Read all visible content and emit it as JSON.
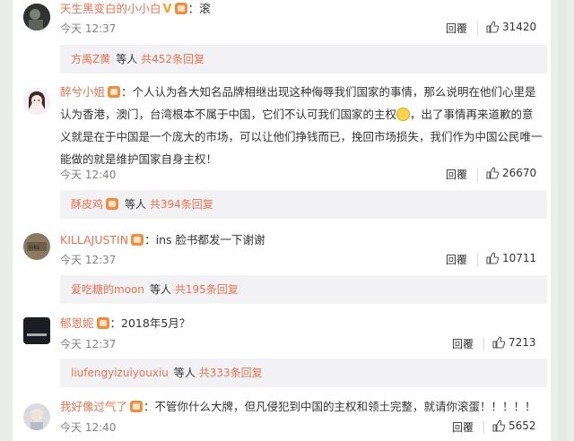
{
  "comments": [
    {
      "username": "天生黑变白的小小白",
      "text": "：滚",
      "time": "今天 12:37",
      "reply": "回覆",
      "likes": "31420",
      "sub_name": "方禹Z黄",
      "sub_etc": "等人",
      "sub_count": "共452条回复"
    },
    {
      "username": "醉兮小姐",
      "text_line1": "：个人认为各大知名品牌相继出现这种侮辱我们国家的事情，那么说明在他们心里是",
      "text_line2a": "认为香港，澳门，台湾根本不属于中国，它们不认可我们国家的主权",
      "text_line2b": "，出了事情再来道歉的意",
      "text_line3": "义就是在于中国是一个庞大的市场，可以让他们挣钱而已，挽回市场损失，我们作为中国公民唯一",
      "text_line4": "能做的就是维护国家自身主权！",
      "time": "今天 12:40",
      "reply": "回覆",
      "likes": "26670",
      "sub_name": "酥皮鸡",
      "sub_etc": "等人",
      "sub_count": "共394条回复"
    },
    {
      "username": "KILLAJUSTIN",
      "text": "：ins 脸书都发一下谢谢",
      "time": "今天 12:37",
      "reply": "回覆",
      "likes": "10711",
      "sub_name": "爱吃糖的moon",
      "sub_etc": "等人",
      "sub_count": "共195条回复"
    },
    {
      "username": "郁恩妮",
      "text": "：2018年5月？",
      "time": "今天 12:37",
      "reply": "回覆",
      "likes": "7213",
      "sub_name": "liufengyizuiyouxiu",
      "sub_etc": "等人",
      "sub_count": "共333条回复"
    },
    {
      "username": "我好像过气了",
      "text": "：不管你什么大牌，但凡侵犯到中国的主权和领土完整，就请你滚蛋！！！！！",
      "time": "今天 12:40",
      "reply": "回覆",
      "likes": "5652"
    }
  ]
}
